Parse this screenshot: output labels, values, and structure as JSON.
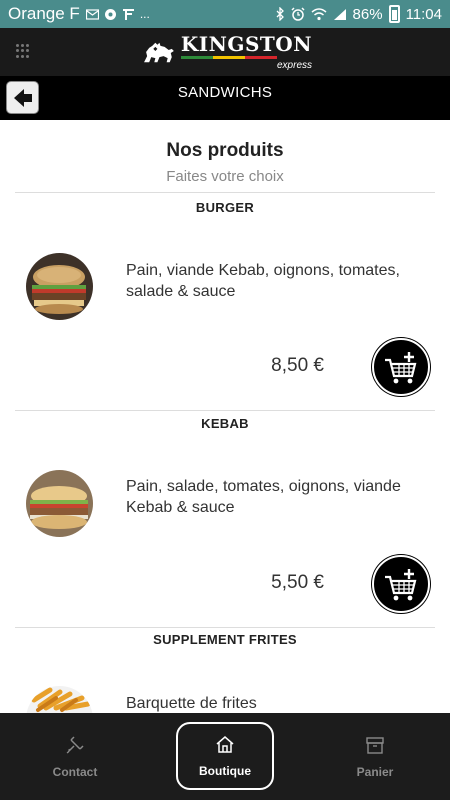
{
  "status_bar": {
    "carrier": "Orange F",
    "notification_icons": [
      "mail-icon",
      "settings-notification-icon",
      "signal-notification-icon"
    ],
    "more": "...",
    "battery": "86%",
    "time": "11:04"
  },
  "header": {
    "brand": "KINGSTON",
    "tagline": "express",
    "stripe_colors": [
      "#2e8b3a",
      "#f2c300",
      "#d4252b"
    ]
  },
  "titlebar": {
    "title": "SANDWICHS"
  },
  "main": {
    "heading": "Nos produits",
    "subheading": "Faites votre choix",
    "products": [
      {
        "category": "BURGER",
        "description": "Pain, viande Kebab, oignons, tomates, salade & sauce",
        "price": "8,50 €"
      },
      {
        "category": "KEBAB",
        "description": "Pain, salade, tomates, oignons, viande Kebab & sauce",
        "price": "5,50 €"
      },
      {
        "category": "SUPPLEMENT FRITES",
        "description": "Barquette de frites"
      }
    ]
  },
  "bottom_nav": {
    "contact": "Contact",
    "boutique": "Boutique",
    "panier": "Panier"
  }
}
